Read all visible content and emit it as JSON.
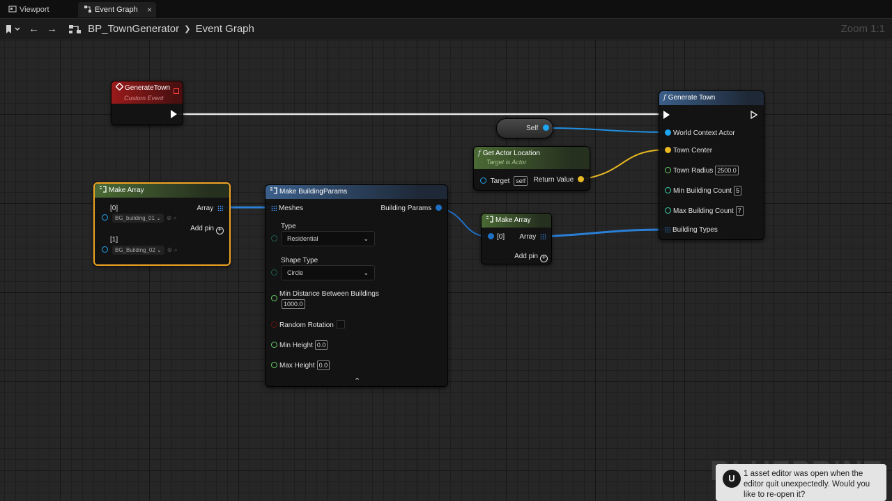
{
  "tabs": [
    {
      "label": "Viewport",
      "active": false
    },
    {
      "label": "Event Graph",
      "active": true,
      "close": "×"
    }
  ],
  "nav": {
    "back": "←",
    "forward": "→",
    "blueprint": "BP_TownGenerator",
    "separator": "❯",
    "graph": "Event Graph",
    "zoom": "Zoom 1:1"
  },
  "watermark": "BLUEPRINT",
  "nodes": {
    "generate_town_event": {
      "title": "GenerateTown",
      "subtitle": "Custom Event"
    },
    "self_node": {
      "label": "Self"
    },
    "get_actor_location": {
      "title": "Get Actor Location",
      "subtitle": "Target is Actor",
      "target_label": "Target",
      "target_value": "self",
      "return_label": "Return Value"
    },
    "generate_town_fn": {
      "title": "Generate Town",
      "pins": {
        "world_context": "World Context Actor",
        "town_center": "Town Center",
        "town_radius": "Town Radius",
        "town_radius_value": "2500.0",
        "min_count": "Min Building Count",
        "min_count_value": "5",
        "max_count": "Max Building Count",
        "max_count_value": "7",
        "building_types": "Building Types"
      }
    },
    "make_array_meshes": {
      "title": "Make Array",
      "item0_label": "[0]",
      "item0_value": "BG_building_01",
      "item1_label": "[1]",
      "item1_value": "BG_Building_02",
      "output_label": "Array",
      "add_pin": "Add pin"
    },
    "make_building_params": {
      "title": "Make BuildingParams",
      "meshes": "Meshes",
      "output": "Building Params",
      "type_label": "Type",
      "type_value": "Residential",
      "shape_label": "Shape Type",
      "shape_value": "Circle",
      "min_distance_label": "Min Distance Between Buildings",
      "min_distance_value": "1000.0",
      "random_rotation_label": "Random Rotation",
      "min_height_label": "Min Height",
      "min_height_value": "0.0",
      "max_height_label": "Max Height",
      "max_height_value": "0.0",
      "collapse": "⌃"
    },
    "make_array_types": {
      "title": "Make Array",
      "item0_label": "[0]",
      "output_label": "Array",
      "add_pin": "Add pin"
    }
  },
  "toast": {
    "logo": "U",
    "message": "1 asset editor was open when the editor quit unexpectedly. Would you like to re-open it?"
  },
  "colors": {
    "exec_wire": "#ffffff",
    "object_wire": "#1f8fe0",
    "vector_wire": "#e8b923",
    "array_wire": "#2a7fd6",
    "selected_outline": "#f0a424"
  }
}
